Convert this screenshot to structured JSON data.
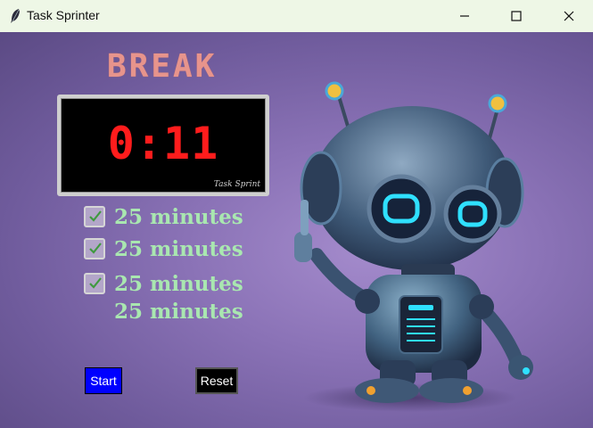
{
  "window": {
    "title": "Task Sprinter"
  },
  "timer": {
    "mode": "BREAK",
    "time": "0:11",
    "brand": "Task Sprint"
  },
  "sessions": [
    {
      "label": "25 minutes",
      "checked": true
    },
    {
      "label": "25 minutes",
      "checked": true
    },
    {
      "label": "25 minutes",
      "checked": true
    },
    {
      "label": "25 minutes",
      "checked": false
    }
  ],
  "buttons": {
    "start": "Start",
    "reset": "Reset"
  },
  "colors": {
    "mode": "#e7948c",
    "digits": "#ff1c1c",
    "session_text": "#a9e7b0",
    "start_bg": "#0000ff",
    "reset_bg": "#000000"
  }
}
